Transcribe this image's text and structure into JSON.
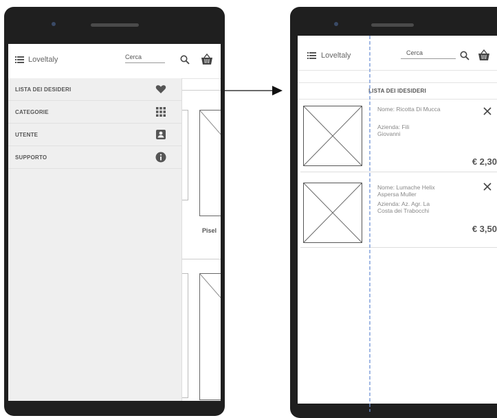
{
  "left_screen": {
    "brand": "Loveltaly",
    "search_label": "Cerca",
    "drawer_items": [
      {
        "label": "LISTA DEI DESIDERI",
        "icon": "heart-icon"
      },
      {
        "label": "CATEGORIE",
        "icon": "grid-icon"
      },
      {
        "label": "UTENTE",
        "icon": "user-card-icon"
      },
      {
        "label": "SUPPORTO",
        "icon": "info-icon"
      }
    ],
    "background_label": "Pisel"
  },
  "right_screen": {
    "brand": "Loveltaly",
    "search_label": "Cerca",
    "section_title": "LISTA DEI IDESIDERI",
    "items": [
      {
        "name": "Nome: Ricotta Di Mucca",
        "company": "Azienda: Fili Giovanni",
        "price": "€ 2,30"
      },
      {
        "name": "Nome: Lumache Helix Aspersa Muller",
        "company": "Azienda: Az. Agr. La Costa dei Trabocchi",
        "price": "€ 3,50"
      }
    ]
  },
  "colors": {
    "phone_body": "#1f1f1f",
    "drawer_bg": "#efefef",
    "guide_line": "#6f93d6"
  }
}
